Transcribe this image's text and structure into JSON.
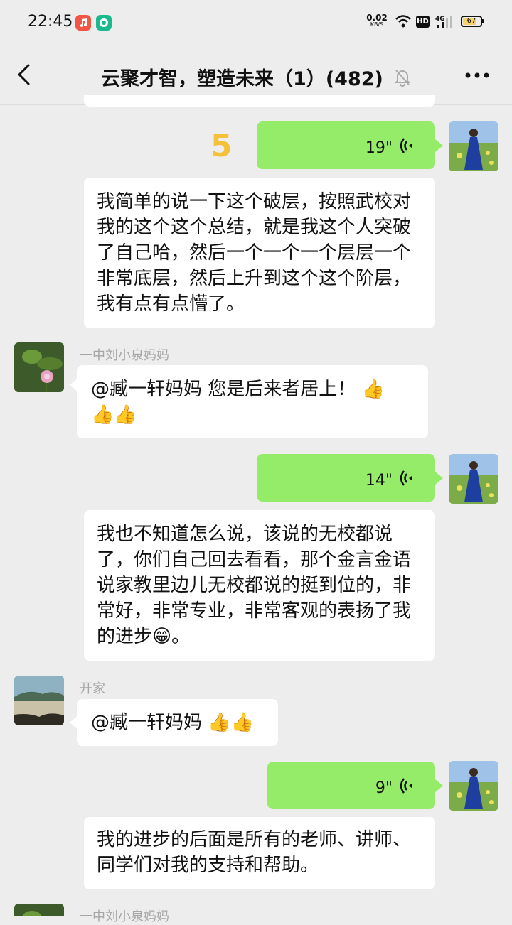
{
  "status_bar": {
    "time": "22:45",
    "net_speed_value": "0.02",
    "net_speed_unit": "KB/S",
    "hd_label": "HD",
    "network_type": "4G",
    "battery_level": "67"
  },
  "header": {
    "title": "云聚才智，塑造未来（1）(482)",
    "back_icon": "chevron-left-icon",
    "mute_icon": "bell-off-icon",
    "more_icon": "more-dots-icon"
  },
  "overlay_number": "5",
  "messages": [
    {
      "type": "voice",
      "side": "right",
      "duration": "19\""
    },
    {
      "type": "text",
      "side": "center",
      "text": "我简单的说一下这个破层，按照武校对我的这个这个总结，就是我这个人突破了自己哈，然后一个一个一个层层一个非常底层，然后上升到这个这个阶层，我有点有点懵了。"
    },
    {
      "type": "text",
      "side": "left",
      "sender": "一中刘小泉妈妈",
      "line1": "@臧一轩妈妈  您是后来者居上！",
      "emoji": "👍"
    },
    {
      "type": "voice",
      "side": "right",
      "duration": "14\""
    },
    {
      "type": "text",
      "side": "center",
      "text": "我也不知道怎么说，该说的无校都说了，你们自己回去看看，那个金言金语说家教里边儿无校都说的挺到位的，非常好，非常专业，非常客观的表扬了我的进步😁。"
    },
    {
      "type": "text",
      "side": "left",
      "sender": "开家",
      "text": "@臧一轩妈妈  👍👍"
    },
    {
      "type": "voice",
      "side": "right",
      "duration": "9\""
    },
    {
      "type": "text",
      "side": "center",
      "text": "我的进步的后面是所有的老师、讲师、同学们对我的支持和帮助。"
    },
    {
      "type": "partial",
      "side": "left",
      "sender": "一中刘小泉妈妈"
    }
  ]
}
